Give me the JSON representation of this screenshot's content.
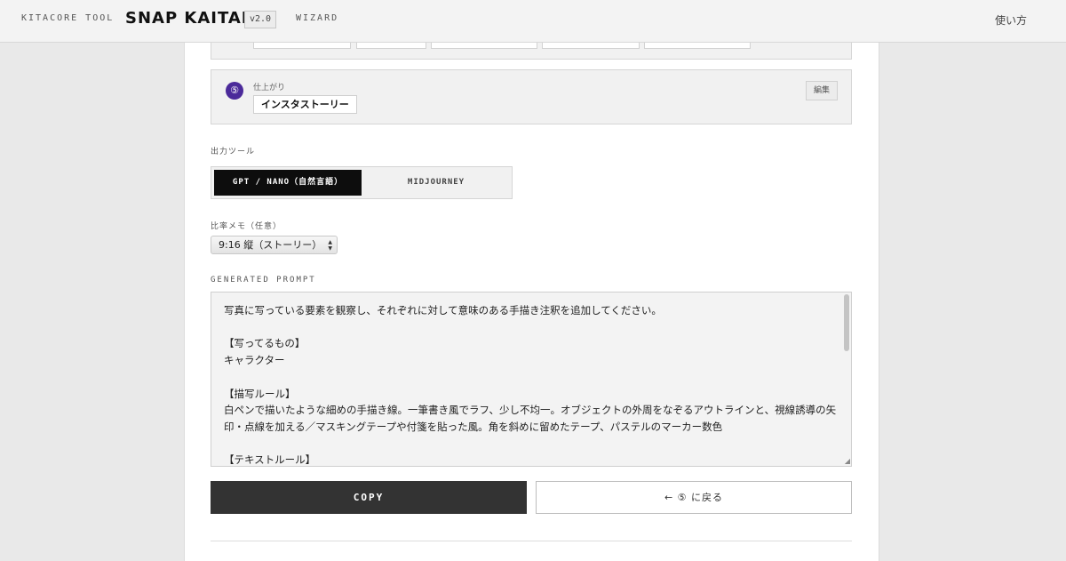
{
  "header": {
    "brand_sub": "KITACORE TOOL",
    "brand": "SNAP KAITARO",
    "version": "v2.0",
    "wizard": "WIZARD",
    "howto": "使い方"
  },
  "step5": {
    "badge": "⑤",
    "label": "仕上がり",
    "value": "インスタストーリー",
    "edit_label": "編集"
  },
  "output_tool": {
    "label": "出力ツール",
    "options": [
      "GPT / NANO（自然言語）",
      "MIDJOURNEY"
    ],
    "selected": "GPT / NANO（自然言語）"
  },
  "ratio": {
    "label": "比率メモ（任意）",
    "selected": "9:16 縦（ストーリー）"
  },
  "prompt": {
    "label": "GENERATED PROMPT",
    "text": "写真に写っている要素を観察し、それぞれに対して意味のある手描き注釈を追加してください。\n\n【写ってるもの】\nキャラクター\n\n【描写ルール】\n白ペンで描いたような細めの手描き線。一筆書き風でラフ、少し不均一。オブジェクトの外周をなぞるアウトラインと、視線誘導の矢印・点線を加える／マスキングテープや付箋を貼った風。角を斜めに留めたテープ、パステルのマーカー数色\n\n【テキストルール】"
  },
  "actions": {
    "copy_label": "COPY",
    "back_label": "← ⑤ に戻る"
  },
  "colors": {
    "accent_badge": "#4b2a9a",
    "active_toggle": "#0d0d0d",
    "copy_button": "#333333"
  }
}
